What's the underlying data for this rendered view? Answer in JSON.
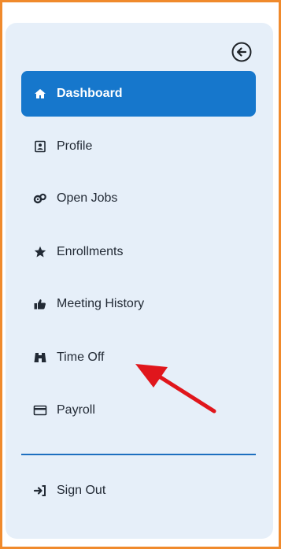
{
  "sidebar": {
    "collapse_icon": "arrow-left-circle-icon",
    "items": [
      {
        "label": "Dashboard",
        "icon": "home-icon",
        "active": true
      },
      {
        "label": "Profile",
        "icon": "id-badge-icon"
      },
      {
        "label": "Open Jobs",
        "icon": "gears-icon"
      },
      {
        "label": "Enrollments",
        "icon": "star-icon"
      },
      {
        "label": "Meeting History",
        "icon": "thumbs-up-icon"
      },
      {
        "label": "Time Off",
        "icon": "binoculars-icon"
      },
      {
        "label": "Payroll",
        "icon": "credit-card-icon"
      }
    ],
    "footer": {
      "label": "Sign Out",
      "icon": "sign-in-icon"
    }
  },
  "colors": {
    "frame_border": "#f08a2c",
    "panel_bg": "#e6eff9",
    "active_bg": "#1677cc",
    "divider": "#1d6fc0",
    "annotation_arrow": "#e0161c"
  }
}
